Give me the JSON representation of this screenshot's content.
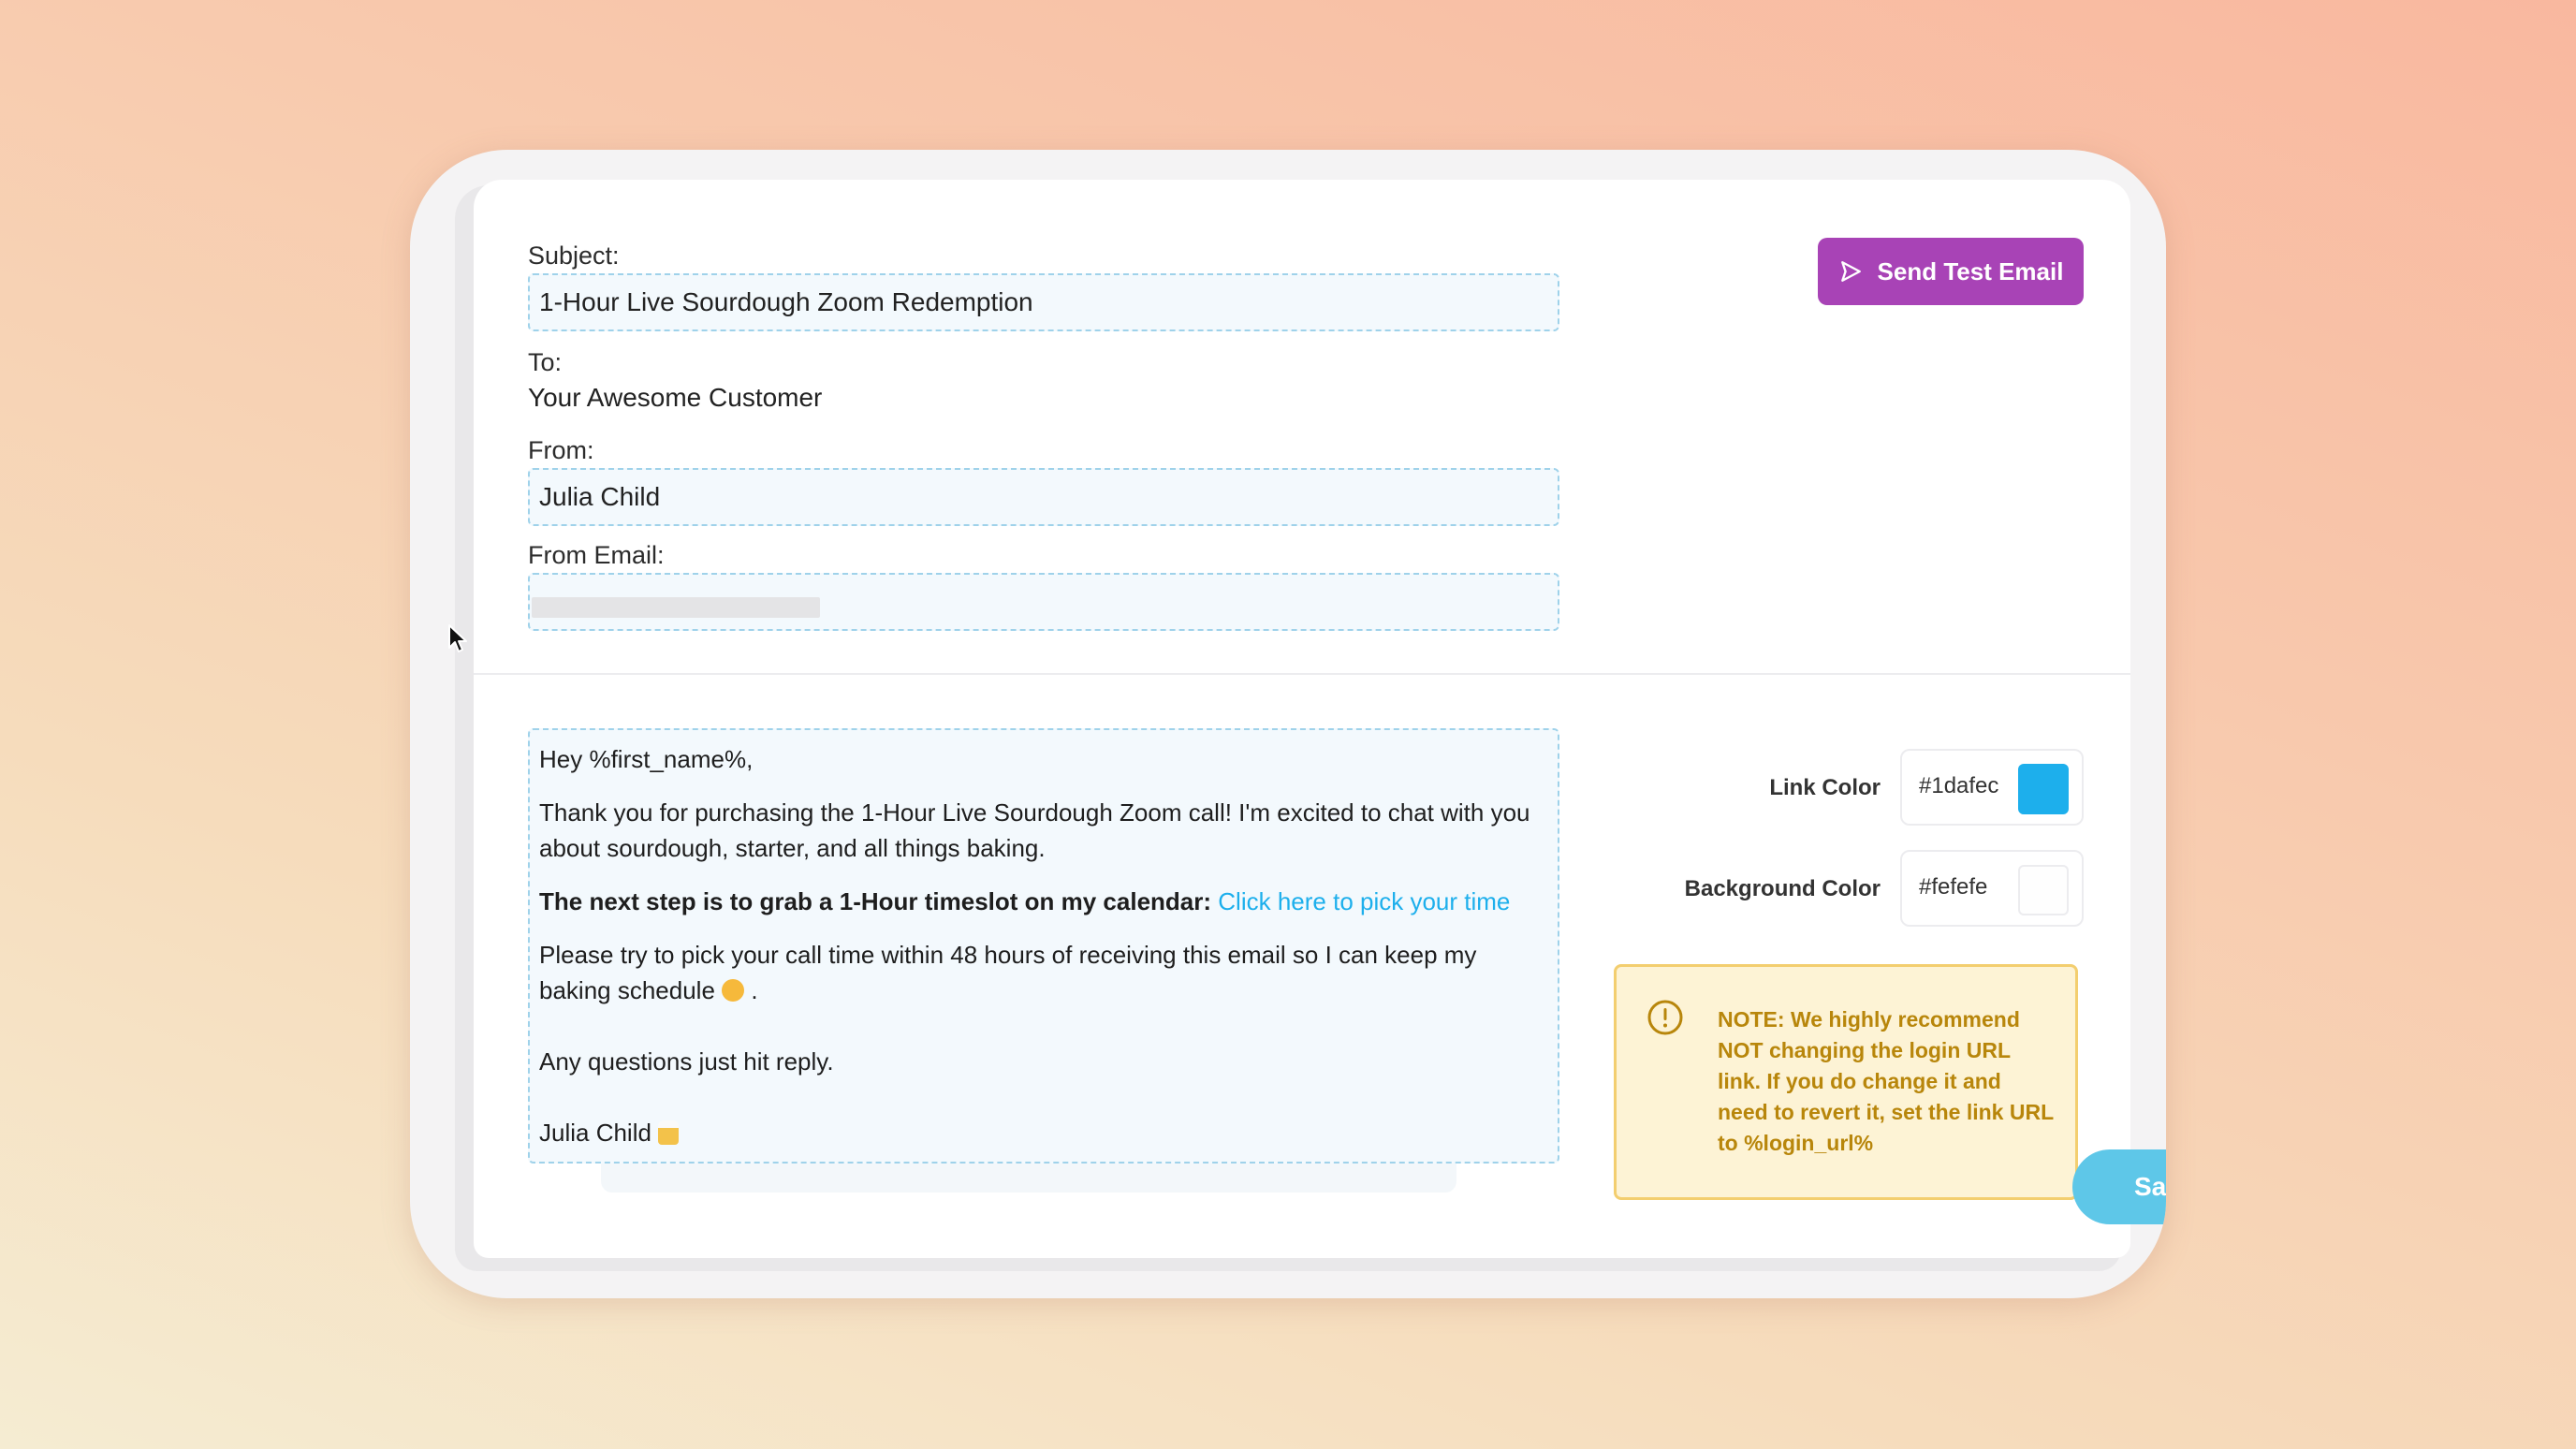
{
  "header": {
    "subject_label": "Subject:",
    "subject_value": "1-Hour Live Sourdough Zoom Redemption",
    "to_label": "To:",
    "to_value": "Your Awesome Customer",
    "from_label": "From:",
    "from_value": "Julia Child",
    "from_email_label": "From Email:",
    "send_test_label": "Send Test Email"
  },
  "body": {
    "greeting": "Hey %first_name%,",
    "para1": "Thank you for purchasing the 1-Hour Live Sourdough Zoom call! I'm excited to chat with you about sourdough, starter, and all things baking.",
    "next_step_bold": "The next step is to grab a 1-Hour timeslot on my calendar:",
    "next_step_link": "Click here to pick your time",
    "para3": "Please try to pick your call time within 48 hours of receiving this email so I can keep my baking schedule",
    "para3_end": ".",
    "questions": "Any questions just hit reply.",
    "signature": "Julia Child"
  },
  "settings": {
    "link_color_label": "Link Color",
    "link_color_value": "#1dafec",
    "background_color_label": "Background Color",
    "background_color_value": "#fefefe",
    "note": "NOTE: We highly recommend NOT changing the login URL link. If you do change it and need to revert it, set the link URL to %login_url%",
    "save_label": "Sa"
  },
  "colors": {
    "accent_purple": "#a843b6",
    "link_blue": "#1dafec",
    "note_bg": "#fdf3d5",
    "note_text": "#b8860b",
    "save_blue": "#5ec7e8"
  }
}
